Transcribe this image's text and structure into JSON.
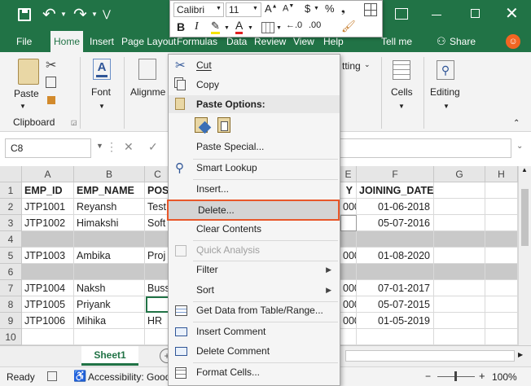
{
  "quick_access": {
    "save": "save-icon",
    "undo": "undo-icon",
    "redo": "redo-icon"
  },
  "tabs": [
    "File",
    "Home",
    "Insert",
    "Page Layout",
    "Formulas",
    "Data",
    "Review",
    "View",
    "Help",
    "Tell me",
    "Share"
  ],
  "ribbon": {
    "paste_label": "Paste",
    "clipboard_label": "Clipboard",
    "font_label": "Font",
    "alignment_label": "Alignme",
    "formatting_label": "tting",
    "cells_label": "Cells",
    "editing_label": "Editing"
  },
  "mini_toolbar": {
    "font_name": "Calibri",
    "font_size": "11",
    "currency": "$",
    "percent": "%"
  },
  "name_box": "C8",
  "columns": [
    "A",
    "B",
    "C",
    "D",
    "E",
    "F",
    "G",
    "H"
  ],
  "rows": [
    {
      "num": "1",
      "cells": [
        "EMP_ID",
        "EMP_NAME",
        "POS",
        "",
        "Y",
        "JOINING_DATE",
        "",
        ""
      ]
    },
    {
      "num": "2",
      "cells": [
        "JTP1001",
        "Reyansh",
        "Test",
        "",
        "000",
        "01-06-2018",
        "",
        ""
      ]
    },
    {
      "num": "3",
      "cells": [
        "JTP1002",
        "Himakshi",
        "Soft",
        "",
        "",
        "05-07-2016",
        "",
        ""
      ]
    },
    {
      "num": "4",
      "cells": [
        "",
        "",
        "",
        "",
        "",
        "",
        "",
        ""
      ]
    },
    {
      "num": "5",
      "cells": [
        "JTP1003",
        "Ambika",
        "Proj",
        "",
        "000",
        "01-08-2020",
        "",
        ""
      ]
    },
    {
      "num": "6",
      "cells": [
        "",
        "",
        "",
        "",
        "",
        "",
        "",
        ""
      ]
    },
    {
      "num": "7",
      "cells": [
        "JTP1004",
        "Naksh",
        "Buss",
        "",
        "000",
        "07-01-2017",
        "",
        ""
      ]
    },
    {
      "num": "8",
      "cells": [
        "JTP1005",
        "Priyank",
        "",
        "",
        "000",
        "05-07-2015",
        "",
        ""
      ]
    },
    {
      "num": "9",
      "cells": [
        "JTP1006",
        "Mihika",
        "HR",
        "",
        "000",
        "01-05-2019",
        "",
        ""
      ]
    },
    {
      "num": "10",
      "cells": [
        "",
        "",
        "",
        "",
        "",
        "",
        "",
        ""
      ]
    }
  ],
  "sheet_tab": "Sheet1",
  "status": {
    "ready": "Ready",
    "accessibility": "Accessibility: Good",
    "zoom": "100%"
  },
  "context_menu": {
    "cut": "Cut",
    "copy": "Copy",
    "paste_options": "Paste Options:",
    "paste_special": "Paste Special...",
    "smart_lookup": "Smart Lookup",
    "insert": "Insert...",
    "delete": "Delete...",
    "clear_contents": "Clear Contents",
    "quick_analysis": "Quick Analysis",
    "filter": "Filter",
    "sort": "Sort",
    "get_data": "Get Data from Table/Range...",
    "insert_comment": "Insert Comment",
    "delete_comment": "Delete Comment",
    "format_cells": "Format Cells..."
  },
  "colors": {
    "excel_green": "#217346",
    "highlight": "#e8572a",
    "header_grey": "#e6e6e6"
  }
}
